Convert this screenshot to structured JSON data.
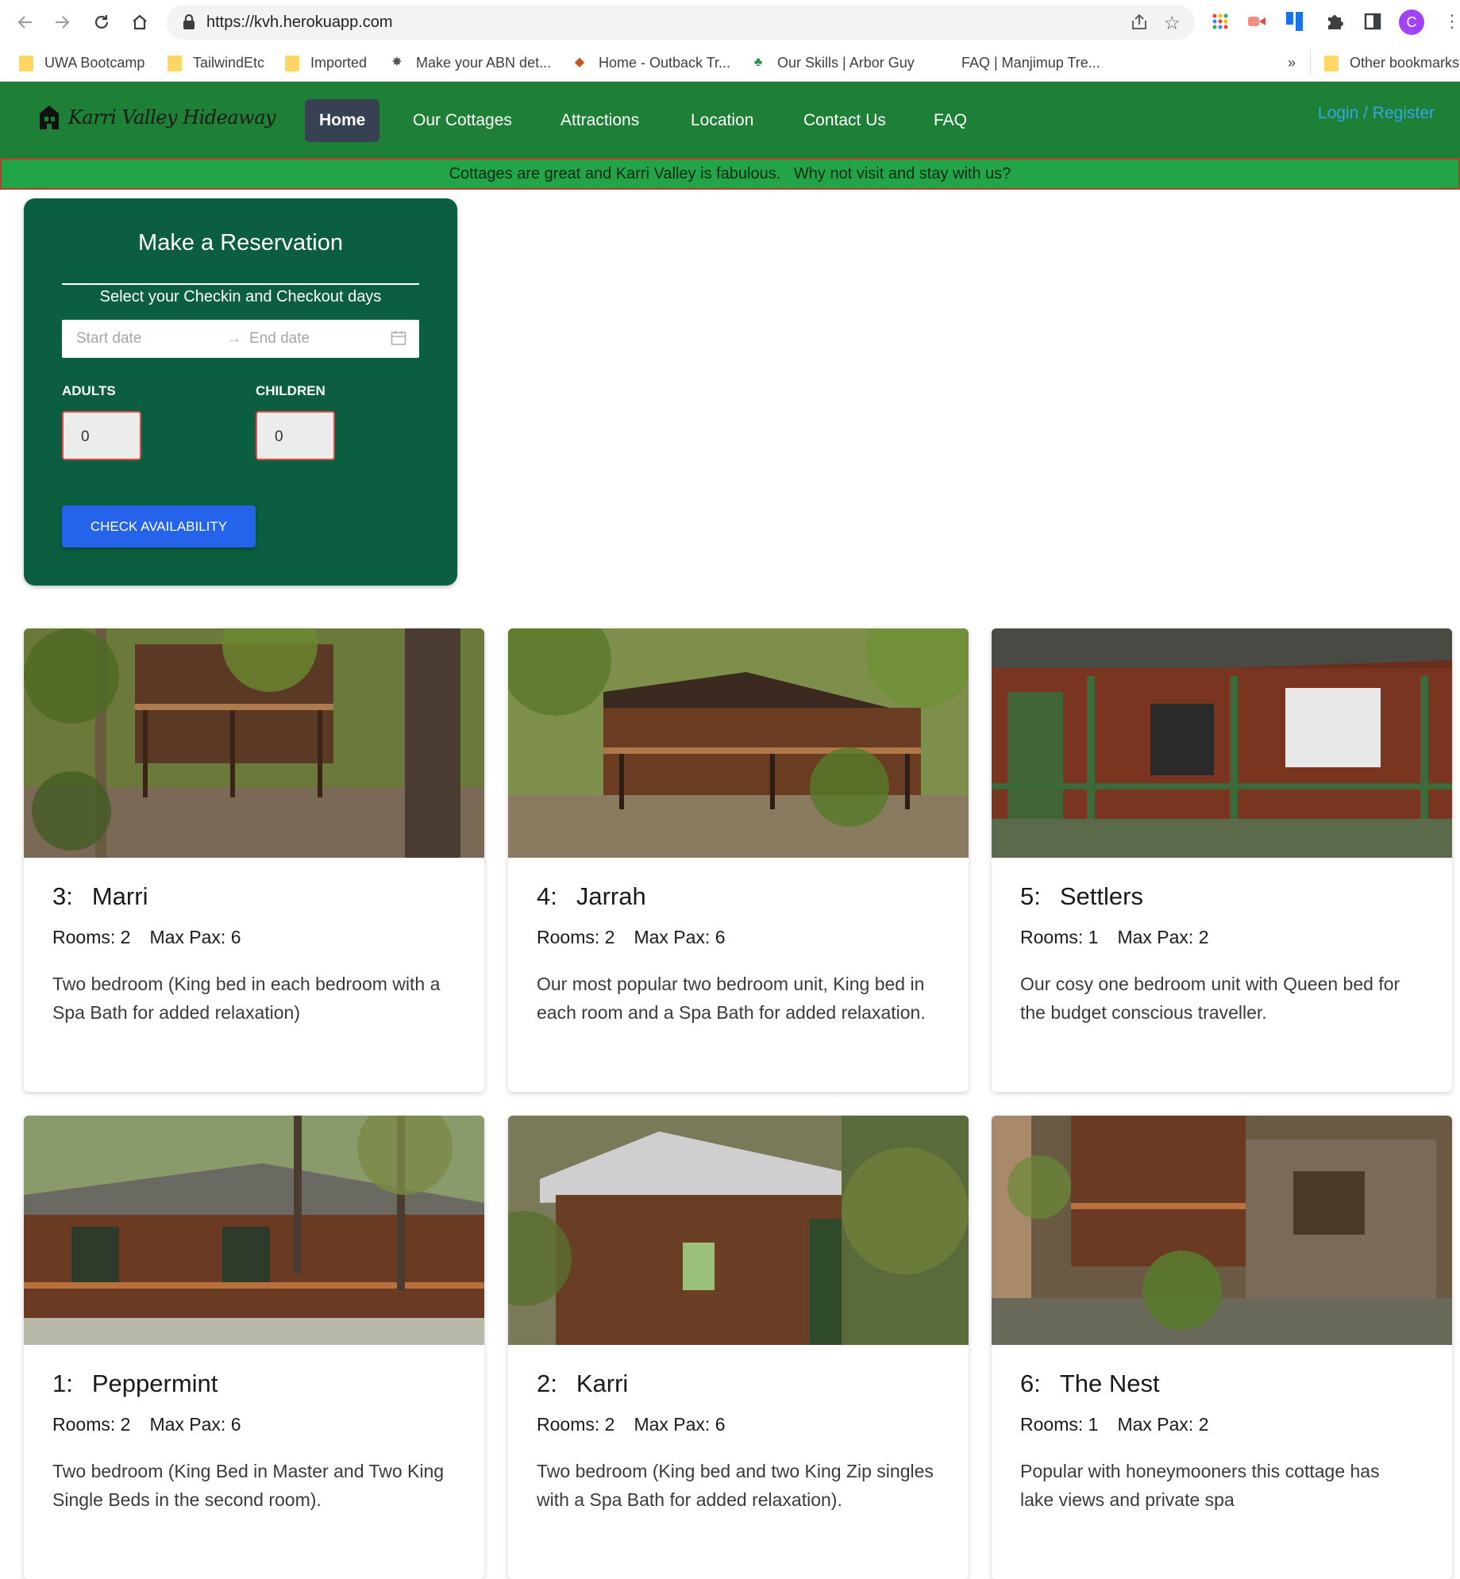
{
  "browser": {
    "url": "https://kvh.herokuapp.com",
    "avatar_letter": "C",
    "bookmarks": [
      {
        "label": "UWA Bootcamp",
        "icon": "folder-icon"
      },
      {
        "label": "TailwindEtc",
        "icon": "folder-icon"
      },
      {
        "label": "Imported",
        "icon": "folder-icon"
      },
      {
        "label": "Make your ABN det...",
        "icon": "crest-icon"
      },
      {
        "label": "Home - Outback Tr...",
        "icon": "australia-icon"
      },
      {
        "label": "Our Skills | Arbor Guy",
        "icon": "palm-icon"
      },
      {
        "label": "FAQ | Manjimup Tre...",
        "icon": ""
      }
    ],
    "overflow": "»",
    "other_bookmarks": "Other bookmarks"
  },
  "site": {
    "logo_text": "Karri Valley Hideaway",
    "nav": [
      "Home",
      "Our Cottages",
      "Attractions",
      "Location",
      "Contact Us",
      "FAQ"
    ],
    "active_nav": "Home",
    "login": "Login / Register",
    "banner": "Cottages are great and Karri Valley is fabulous.   Why not visit and stay with us?",
    "colors": {
      "header": "#1e7f36",
      "banner": "#22a548",
      "panel": "#0b5e3f",
      "button": "#2563eb",
      "active_nav": "#374151",
      "login_link": "#2ea8e6"
    }
  },
  "reservation": {
    "title": "Make a Reservation",
    "subtitle": "Select your Checkin and Checkout days",
    "start_placeholder": "Start date",
    "end_placeholder": "End date",
    "adults_label": "ADULTS",
    "adults_value": "0",
    "children_label": "CHILDREN",
    "children_value": "0",
    "button": "CHECK AVAILABILITY"
  },
  "cottages": [
    {
      "number": "3:",
      "name": "Marri",
      "rooms": "Rooms: 2",
      "pax": "Max Pax: 6",
      "description": "Two bedroom (King bed in each bedroom with a Spa Bath for added relaxation)"
    },
    {
      "number": "4:",
      "name": "Jarrah",
      "rooms": "Rooms: 2",
      "pax": "Max Pax: 6",
      "description": "Our most popular two bedroom unit, King bed in each room and a Spa Bath for added relaxation."
    },
    {
      "number": "5:",
      "name": "Settlers",
      "rooms": "Rooms: 1",
      "pax": "Max Pax: 2",
      "description": "Our cosy one bedroom unit with Queen bed for the budget conscious traveller."
    },
    {
      "number": "1:",
      "name": "Peppermint",
      "rooms": "Rooms: 2",
      "pax": "Max Pax: 6",
      "description": "Two bedroom (King Bed in Master and Two King Single Beds in the second room)."
    },
    {
      "number": "2:",
      "name": "Karri",
      "rooms": "Rooms: 2",
      "pax": "Max Pax: 6",
      "description": "Two bedroom (King bed and two King Zip singles with a Spa Bath for added relaxation)."
    },
    {
      "number": "6:",
      "name": "The Nest",
      "rooms": "Rooms: 1",
      "pax": "Max Pax: 2",
      "description": "Popular with honeymooners this cottage has lake views and private spa"
    }
  ]
}
